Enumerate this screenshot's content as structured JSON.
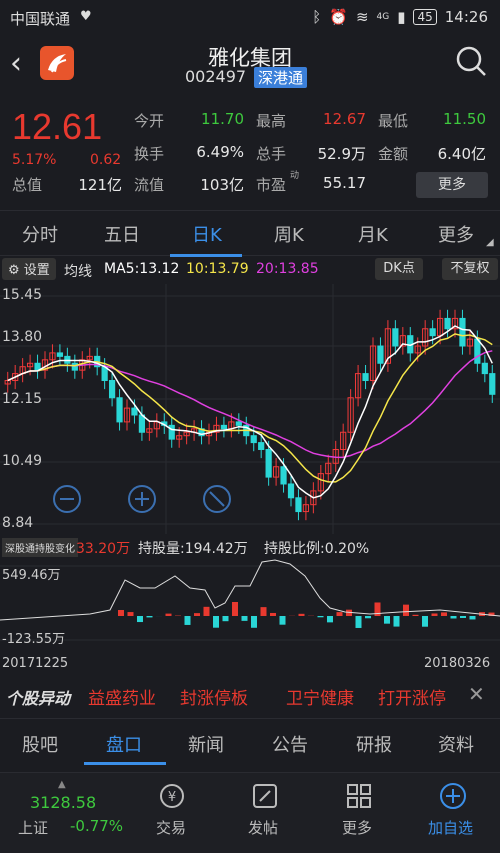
{
  "status_bar": {
    "carrier": "中国联通",
    "battery": "45",
    "time": "14:26",
    "signal": "4G"
  },
  "header": {
    "title": "雅化集团",
    "code": "002497",
    "tag": "深港通"
  },
  "quote": {
    "price": "12.61",
    "change_pct": "5.17%",
    "change": "0.62",
    "open_label": "今开",
    "open": "11.70",
    "high_label": "最高",
    "high": "12.67",
    "low_label": "最低",
    "low": "11.50",
    "turnover_label": "换手",
    "turnover": "6.49%",
    "volume_label": "总手",
    "volume": "52.9万",
    "amount_label": "金额",
    "amount": "6.40亿",
    "mktcap_label": "总值",
    "mktcap": "121亿",
    "float_label": "流值",
    "float": "103亿",
    "pe_label": "市盈",
    "pe_sup": "动",
    "pe": "55.17",
    "more_label": "更多"
  },
  "tabs": [
    "分时",
    "五日",
    "日K",
    "周K",
    "月K",
    "更多"
  ],
  "active_tab": 2,
  "chart_toolbar": {
    "settings_label": "设置",
    "ma_label": "均线",
    "ma5": "MA5:13.12",
    "ma10": "10:13.79",
    "ma20": "20:13.85",
    "dk_label": "DK点",
    "adjust_label": "不复权",
    "ma5_color": "#ffffff",
    "ma10_color": "#f5e64a",
    "ma20_color": "#e040e0"
  },
  "kline_axis": [
    "15.45",
    "13.80",
    "12.15",
    "10.49",
    "8.84"
  ],
  "hk_panel": {
    "label": "深股通持股变化",
    "value": "33.20万",
    "holding": "持股量:194.42万",
    "ratio": "持股比例:0.20%",
    "axis_top": "549.46万",
    "axis_bottom": "-123.55万"
  },
  "dates": {
    "start": "20171225",
    "end": "20180326"
  },
  "news": {
    "logo": "个股异动",
    "items": [
      "益盛药业",
      "封涨停板",
      "卫宁健康",
      "打开涨停"
    ]
  },
  "bottom_tabs": [
    "股吧",
    "盘口",
    "新闻",
    "公告",
    "研报",
    "资料"
  ],
  "active_bottom_tab": 1,
  "nav": {
    "index_value": "3128.58",
    "index_name": "上证",
    "index_pct": "-0.77%",
    "items": [
      "交易",
      "发帖",
      "更多",
      "加自选"
    ]
  },
  "chart_data": {
    "type": "candlestick",
    "y_range": [
      8.84,
      15.45
    ],
    "y_ticks": [
      15.45,
      13.8,
      12.15,
      10.49,
      8.84
    ],
    "x_range": [
      "20171225",
      "20180326"
    ],
    "series": [
      {
        "values_close": [
          13.0,
          13.2,
          13.4,
          13.5,
          13.3,
          13.6,
          13.8,
          13.7,
          13.5,
          13.3,
          13.6,
          13.7,
          13.4,
          13.0,
          12.5,
          11.8,
          12.2,
          12.0,
          11.5,
          11.6,
          11.8,
          11.7,
          11.3,
          11.4,
          11.5,
          11.6,
          11.4,
          11.5,
          11.7,
          11.6,
          11.8,
          11.7,
          11.4,
          11.2,
          11.0,
          10.2,
          10.5,
          10.0,
          9.6,
          9.2,
          9.4,
          9.8,
          10.3,
          10.6,
          11.0,
          11.5,
          12.5,
          13.2,
          13.0,
          14.0,
          13.5,
          14.5,
          14.0,
          14.3,
          13.8,
          14.0,
          14.5,
          14.3,
          14.8,
          14.5,
          14.8,
          14.0,
          14.2,
          13.5,
          13.2,
          12.6
        ]
      }
    ],
    "hk_change_axis": [
      -123.55,
      549.46
    ]
  }
}
